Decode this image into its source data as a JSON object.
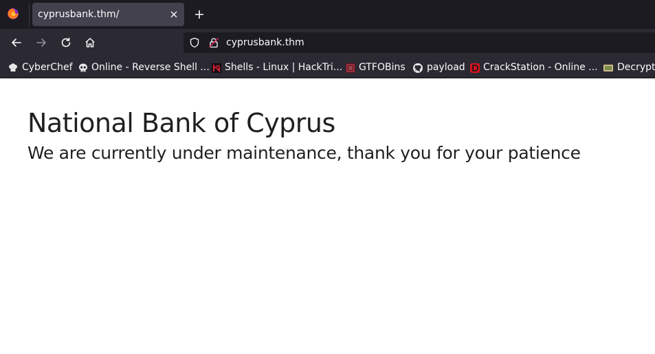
{
  "browser": {
    "tab": {
      "title": "cyprusbank.thm/"
    },
    "url": "cyprusbank.thm"
  },
  "bookmarks": [
    {
      "label": "CyberChef",
      "icon": "chef-hat-icon"
    },
    {
      "label": "Online - Reverse Shell ...",
      "icon": "skull-icon"
    },
    {
      "label": "Shells - Linux | HackTri...",
      "icon": "hacktricks-icon"
    },
    {
      "label": "GTFOBins",
      "icon": "gtfobins-icon"
    },
    {
      "label": "payload",
      "icon": "github-icon"
    },
    {
      "label": "CrackStation - Online ...",
      "icon": "crackstation-icon"
    },
    {
      "label": "Decrypt",
      "icon": "decrypt-icon"
    }
  ],
  "page": {
    "heading": "National Bank of Cyprus",
    "subheading": "We are currently under maintenance, thank you for your patience"
  },
  "colors": {
    "tabstrip": "#1c1b22",
    "toolbar": "#2b2a33",
    "active_tab": "#42414d",
    "page_text": "#1f1f1f"
  }
}
